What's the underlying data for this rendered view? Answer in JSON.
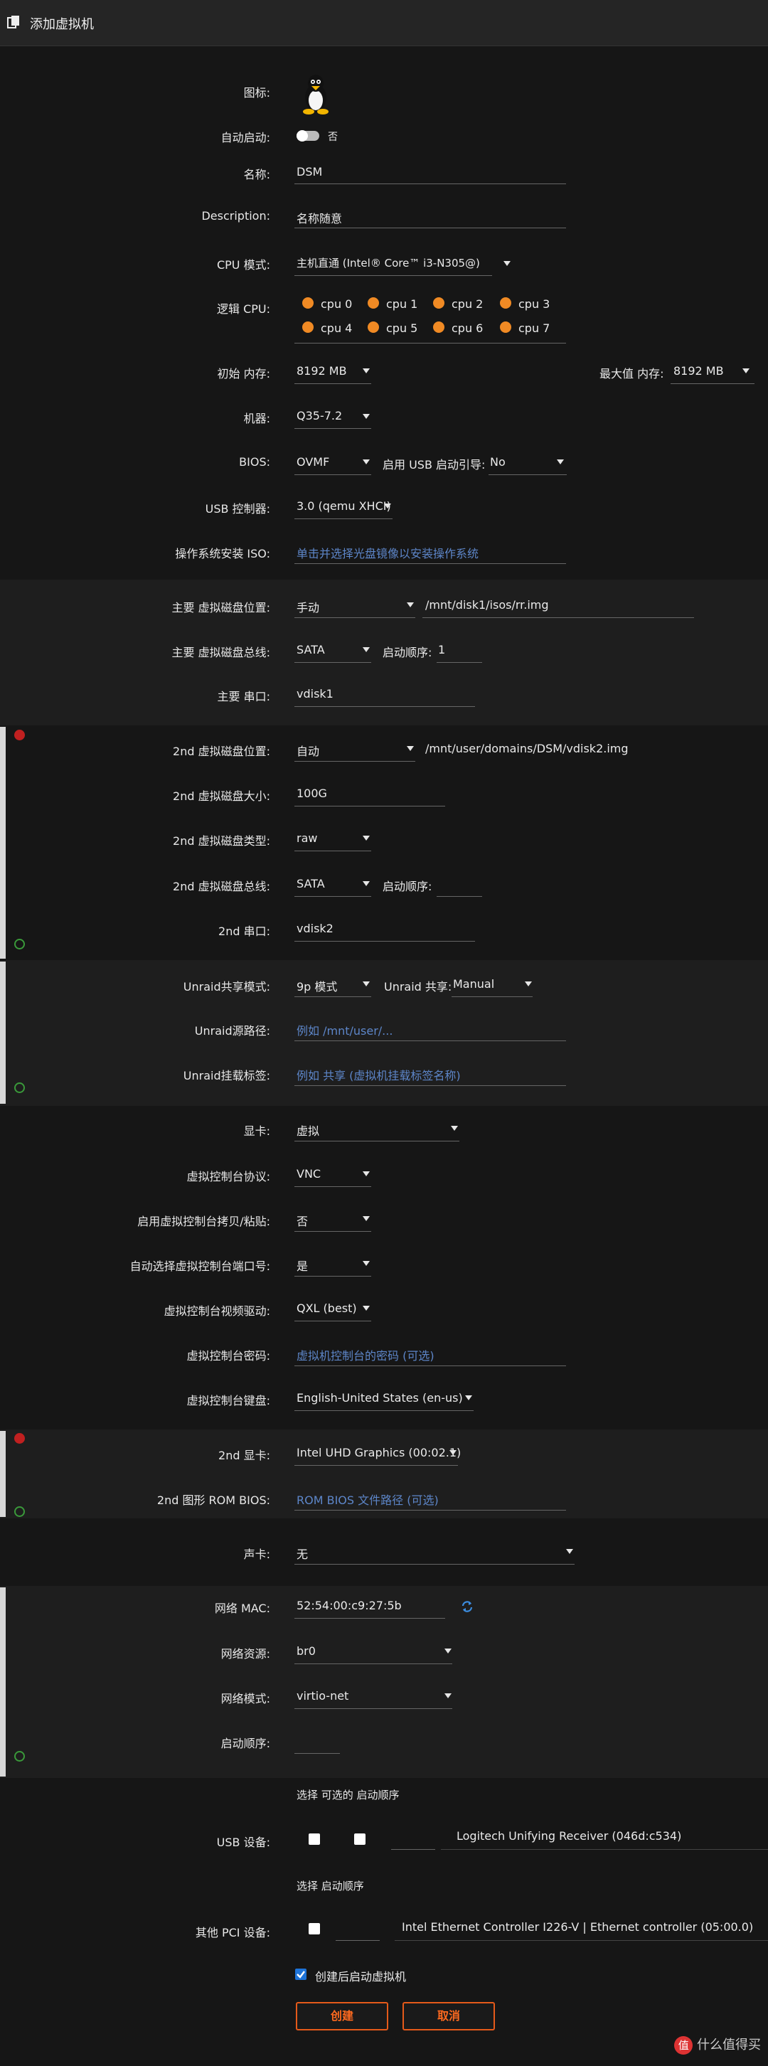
{
  "header": {
    "title": "添加虚拟机"
  },
  "labels": {
    "icon": "图标:",
    "autostart": "自动启动:",
    "name": "名称:",
    "description": "Description:",
    "cpu_mode": "CPU 模式:",
    "logical_cpu": "逻辑 CPU:",
    "init_memory": "初始 内存:",
    "max_memory": "最大值 内存:",
    "machine": "机器:",
    "bios": "BIOS:",
    "usb_boot": "启用 USB 启动引导:",
    "usb_controller": "USB 控制器:",
    "os_iso": "操作系统安装 ISO:",
    "disk1_location": "主要 虚拟磁盘位置:",
    "disk1_bus": "主要 虚拟磁盘总线:",
    "boot_order": "启动顺序:",
    "disk1_serial": "主要 串口:",
    "disk2_location": "2nd 虚拟磁盘位置:",
    "disk2_size": "2nd 虚拟磁盘大小:",
    "disk2_type": "2nd 虚拟磁盘类型:",
    "disk2_bus": "2nd 虚拟磁盘总线:",
    "boot_order2": "启动顺序:",
    "disk2_serial": "2nd 串口:",
    "unraid_share_mode": "Unraid共享模式:",
    "unraid_share": "Unraid 共享:",
    "unraid_source": "Unraid源路径:",
    "unraid_tag": "Unraid挂载标签:",
    "graphics": "显卡:",
    "vnc_protocol": "虚拟控制台协议:",
    "clipboard": "启用虚拟控制台拷贝/粘贴:",
    "auto_port": "自动选择虚拟控制台端口号:",
    "video_driver": "虚拟控制台视频驱动:",
    "console_password": "虚拟控制台密码:",
    "keyboard": "虚拟控制台键盘:",
    "gpu2": "2nd 显卡:",
    "gpu2_rom": "2nd 图形 ROM BIOS:",
    "sound": "声卡:",
    "mac": "网络 MAC:",
    "net_source": "网络资源:",
    "net_model": "网络模式:",
    "net_boot": "启动顺序:",
    "usb_header": "选择  可选的  启动顺序",
    "usb_devices": "USB 设备:",
    "pci_header": "选择  启动顺序",
    "other_pci": "其他 PCI 设备:"
  },
  "values": {
    "autostart": "否",
    "name": "DSM",
    "description": "名称随意",
    "cpu_mode": "主机直通 (Intel® Core™ i3-N305@)",
    "cpus": [
      "cpu 0",
      "cpu 1",
      "cpu 2",
      "cpu 3",
      "cpu 4",
      "cpu 5",
      "cpu 6",
      "cpu 7"
    ],
    "init_memory": "8192 MB",
    "max_memory": "8192 MB",
    "machine": "Q35-7.2",
    "bios": "OVMF",
    "usb_boot": "No",
    "usb_controller": "3.0 (qemu XHCI)",
    "os_iso_placeholder": "单击并选择光盘镜像以安装操作系统",
    "disk1_location": "手动",
    "disk1_path": "/mnt/disk1/isos/rr.img",
    "disk1_bus": "SATA",
    "disk1_boot": "1",
    "disk1_serial": "vdisk1",
    "disk2_location": "自动",
    "disk2_path": "/mnt/user/domains/DSM/vdisk2.img",
    "disk2_size": "100G",
    "disk2_type": "raw",
    "disk2_bus": "SATA",
    "disk2_serial": "vdisk2",
    "unraid_share_mode": "9p 模式",
    "unraid_share": "Manual",
    "unraid_source_placeholder": "例如 /mnt/user/...",
    "unraid_tag_placeholder": "例如 共享 (虚拟机挂载标签名称)",
    "graphics": "虚拟",
    "vnc_protocol": "VNC",
    "clipboard": "否",
    "auto_port": "是",
    "video_driver": "QXL (best)",
    "console_password_placeholder": "虚拟机控制台的密码 (可选)",
    "keyboard": "English-United States (en-us)",
    "gpu2": "Intel UHD Graphics (00:02.1)",
    "gpu2_rom_placeholder": "ROM BIOS 文件路径 (可选)",
    "sound": "无",
    "mac": "52:54:00:c9:27:5b",
    "net_source": "br0",
    "net_model": "virtio-net",
    "usb_device": "Logitech Unifying Receiver (046d:c534)",
    "pci_device": "Intel Ethernet Controller I226-V | Ethernet controller (05:00.0)",
    "start_after_create": "创建后启动虚拟机",
    "create": "创建",
    "cancel": "取消"
  },
  "watermark": "值 什么值得买",
  "colors": {
    "accent": "#f08a24",
    "button": "#ff6a1f",
    "placeholder": "#5d86c9"
  }
}
